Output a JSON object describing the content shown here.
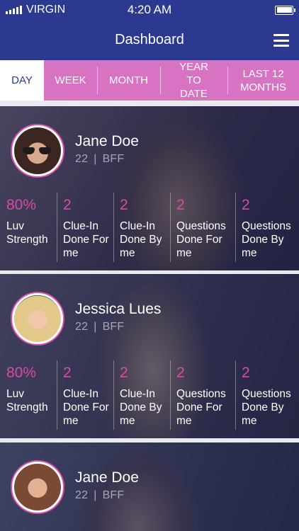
{
  "status_bar": {
    "carrier": "VIRGIN",
    "time": "4:20 AM"
  },
  "header": {
    "title": "Dashboard"
  },
  "tabs": [
    {
      "label": "DAY",
      "active": true
    },
    {
      "label": "WEEK",
      "active": false
    },
    {
      "label": "MONTH",
      "active": false
    },
    {
      "label": "YEAR TO DATE",
      "active": false
    },
    {
      "label": "LAST 12 MONTHS",
      "active": false
    }
  ],
  "cards": [
    {
      "name": "Jane Doe",
      "age": "22",
      "relation": "BFF",
      "stats": [
        {
          "value": "80%",
          "label": "Luv Strength"
        },
        {
          "value": "2",
          "label": "Clue-In Done For me"
        },
        {
          "value": "2",
          "label": "Clue-In Done By me"
        },
        {
          "value": "2",
          "label": "Questions Done For me"
        },
        {
          "value": "2",
          "label": "Questions Done By me"
        }
      ]
    },
    {
      "name": "Jessica Lues",
      "age": "22",
      "relation": "BFF",
      "stats": [
        {
          "value": "80%",
          "label": "Luv Strength"
        },
        {
          "value": "2",
          "label": "Clue-In Done For me"
        },
        {
          "value": "2",
          "label": "Clue-In Done By me"
        },
        {
          "value": "2",
          "label": "Questions Done For me"
        },
        {
          "value": "2",
          "label": "Questions Done By me"
        }
      ]
    },
    {
      "name": "Jane Doe",
      "age": "22",
      "relation": "BFF",
      "stats": []
    }
  ],
  "colors": {
    "primary": "#2b3990",
    "accent": "#d873c3",
    "stat_number": "#d04ea6"
  }
}
